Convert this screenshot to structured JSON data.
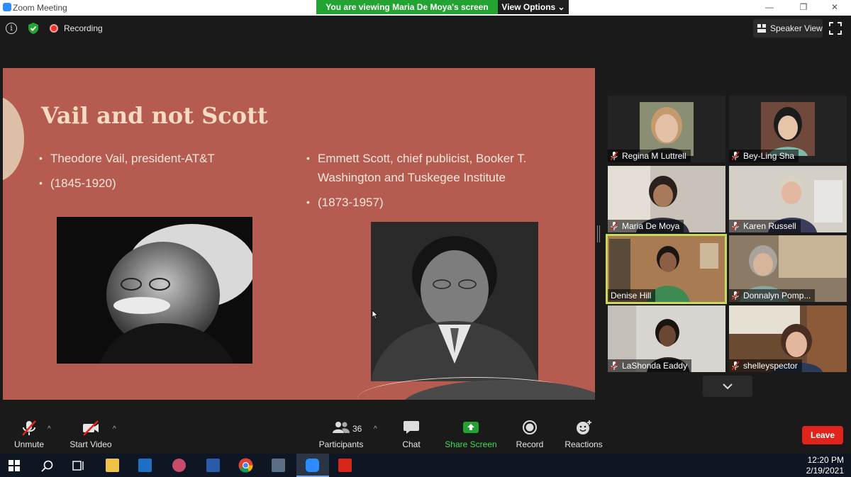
{
  "window": {
    "title": "Zoom Meeting",
    "minimize": "—",
    "restore": "❐",
    "close": "✕"
  },
  "share_banner": {
    "viewing": "You are viewing Maria De Moya's screen",
    "view_options": "View Options ⌄"
  },
  "topbar": {
    "info": "i",
    "recording": "Recording",
    "speaker_view": "Speaker View"
  },
  "slide": {
    "title": "Vail and not Scott",
    "left_bullets": [
      "Theodore Vail, president-AT&T",
      "(1845-1920)"
    ],
    "right_bullets": [
      "Emmett Scott, chief publicist, Booker T. Washington and Tuskegee Institute",
      "(1873-1957)"
    ]
  },
  "participants": [
    {
      "name": "Regina M Luttrell",
      "muted": true
    },
    {
      "name": "Bey-Ling Sha",
      "muted": true
    },
    {
      "name": "Maria De Moya",
      "muted": true
    },
    {
      "name": "Karen Russell",
      "muted": true
    },
    {
      "name": "Denise Hill",
      "muted": false,
      "active": true
    },
    {
      "name": "Donnalyn Pomp...",
      "muted": true
    },
    {
      "name": "LaShonda Eaddy",
      "muted": true
    },
    {
      "name": "shelleyspector",
      "muted": true
    }
  ],
  "toolbar": {
    "unmute": "Unmute",
    "start_video": "Start Video",
    "participants": "Participants",
    "participants_count": "36",
    "chat": "Chat",
    "share_screen": "Share Screen",
    "record": "Record",
    "reactions": "Reactions",
    "leave": "Leave",
    "caret": "^"
  },
  "taskbar": {
    "time": "12:20 PM",
    "date": "2/19/2021"
  },
  "colors": {
    "slide_bg": "#b65b50",
    "share_green": "#23a331",
    "leave_red": "#e0241b",
    "active_speaker_border": "#c8d95a"
  }
}
